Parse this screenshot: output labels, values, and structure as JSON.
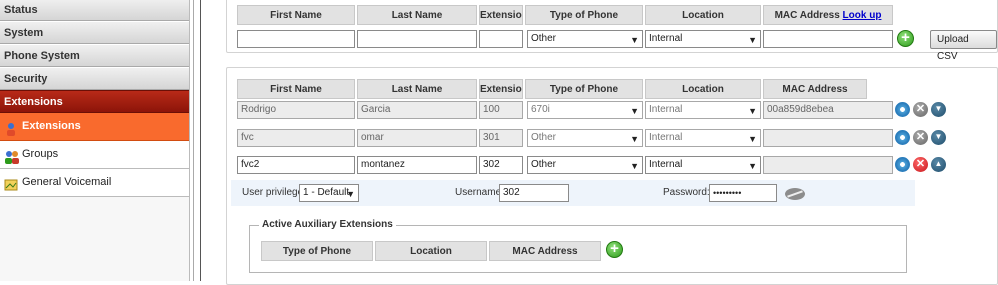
{
  "sidebar": {
    "sections": [
      "Status",
      "System",
      "Phone System",
      "Security",
      "Extensions"
    ],
    "sub_items": [
      {
        "label": "Extensions",
        "icon": "user-icon"
      },
      {
        "label": "Groups",
        "icon": "group-icon"
      },
      {
        "label": "General Voicemail",
        "icon": "voicemail-icon"
      }
    ]
  },
  "add_form": {
    "headers": {
      "first_name": "First Name",
      "last_name": "Last Name",
      "extension": "Extension",
      "phone_type": "Type of Phone",
      "location": "Location",
      "mac": "MAC Address",
      "mac_link": "Look up"
    },
    "values": {
      "first_name": "",
      "last_name": "",
      "extension": "",
      "phone_type": "Other",
      "location": "Internal",
      "mac": ""
    },
    "upload_label": "Upload CSV"
  },
  "list": {
    "headers": {
      "first_name": "First Name",
      "last_name": "Last Name",
      "extension": "Extension",
      "phone_type": "Type of Phone",
      "location": "Location",
      "mac": "MAC Address"
    },
    "rows": [
      {
        "first_name": "Rodrigo",
        "last_name": "Garcia",
        "extension": "100",
        "phone_type": "670i",
        "location": "Internal",
        "mac": "00a859d8ebea"
      },
      {
        "first_name": "fvc",
        "last_name": "omar",
        "extension": "301",
        "phone_type": "Other",
        "location": "Internal",
        "mac": ""
      },
      {
        "first_name": "fvc2",
        "last_name": "montanez",
        "extension": "302",
        "phone_type": "Other",
        "location": "Internal",
        "mac": ""
      }
    ],
    "privilege": {
      "label": "User privilege:",
      "value": "1 - Default",
      "username_label": "Username:",
      "username_value": "302",
      "password_label": "Password:",
      "password_value": "•••••••••"
    },
    "aux": {
      "legend": "Active Auxiliary Extensions",
      "headers": [
        "Type of Phone",
        "Location",
        "MAC Address"
      ]
    }
  },
  "colors": {
    "active_section": "#a11f10",
    "active_item": "#f96a2d",
    "add_button": "#2d9b1a"
  }
}
